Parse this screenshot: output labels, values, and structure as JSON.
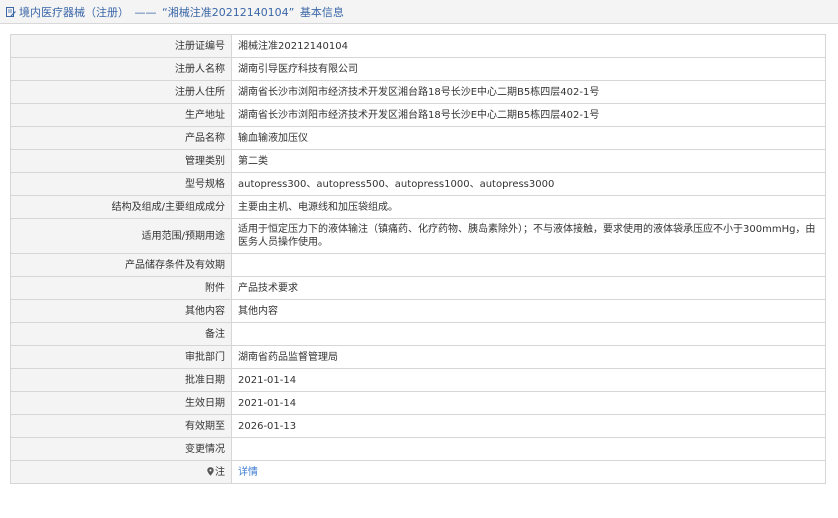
{
  "header": {
    "category": "境内医疗器械（注册）",
    "separator": "——",
    "record_title": "“湘械注准20212140104”",
    "suffix": "基本信息",
    "icon": "document-edit-icon"
  },
  "rows": [
    {
      "label": "注册证编号",
      "value": "湘械注准20212140104"
    },
    {
      "label": "注册人名称",
      "value": "湖南引导医疗科技有限公司"
    },
    {
      "label": "注册人住所",
      "value": "湖南省长沙市浏阳市经济技术开发区湘台路18号长沙E中心二期B5栋四层402-1号"
    },
    {
      "label": "生产地址",
      "value": "湖南省长沙市浏阳市经济技术开发区湘台路18号长沙E中心二期B5栋四层402-1号"
    },
    {
      "label": "产品名称",
      "value": "输血输液加压仪"
    },
    {
      "label": "管理类别",
      "value": "第二类"
    },
    {
      "label": "型号规格",
      "value": "autopress300、autopress500、autopress1000、autopress3000"
    },
    {
      "label": "结构及组成/主要组成成分",
      "value": "主要由主机、电源线和加压袋组成。"
    },
    {
      "label": "适用范围/预期用途",
      "value": "适用于恒定压力下的液体输注（镇痛药、化疗药物、胰岛素除外）；不与液体接触，要求使用的液体袋承压应不小于300mmHg，由医务人员操作使用。"
    },
    {
      "label": "产品储存条件及有效期",
      "value": ""
    },
    {
      "label": "附件",
      "value": "产品技术要求"
    },
    {
      "label": "其他内容",
      "value": "其他内容"
    },
    {
      "label": "备注",
      "value": ""
    },
    {
      "label": "审批部门",
      "value": "湖南省药品监督管理局"
    },
    {
      "label": "批准日期",
      "value": "2021-01-14"
    },
    {
      "label": "生效日期",
      "value": "2021-01-14"
    },
    {
      "label": "有效期至",
      "value": "2026-01-13"
    },
    {
      "label": "变更情况",
      "value": ""
    },
    {
      "label": "注",
      "value": "详情",
      "icon": "location-pin-icon"
    }
  ],
  "colors": {
    "header_text": "#3b67a8",
    "label_bg": "#f4f4f4",
    "border": "#d6d6d6",
    "link": "#3b7bd0"
  }
}
